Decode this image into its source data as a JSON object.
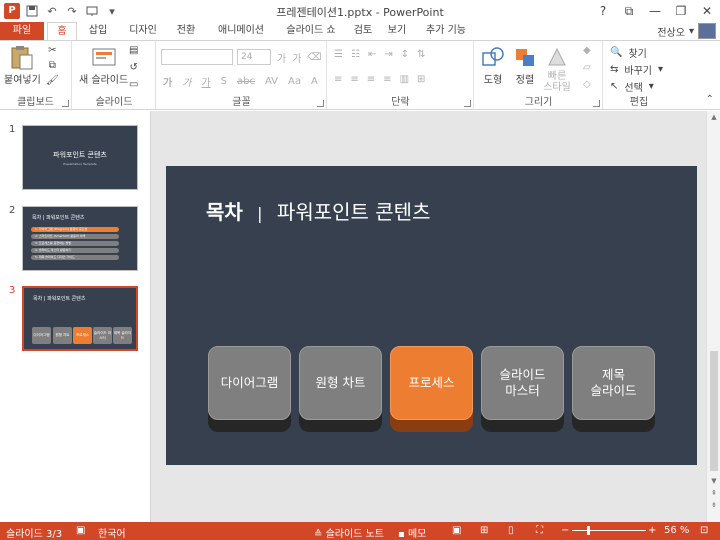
{
  "window": {
    "title": "프레젠테이션1.pptx - PowerPoint",
    "app_icon": "P",
    "controls": [
      "?",
      "⧉",
      "—",
      "❐",
      "✕"
    ]
  },
  "tabs": [
    {
      "label": "파일"
    },
    {
      "label": "홈"
    },
    {
      "label": "삽입"
    },
    {
      "label": "디자인"
    },
    {
      "label": "전환"
    },
    {
      "label": "애니메이션"
    },
    {
      "label": "슬라이드 쇼"
    },
    {
      "label": "검토"
    },
    {
      "label": "보기"
    },
    {
      "label": "추가 기능"
    }
  ],
  "user": {
    "name": "전상오",
    "menu": "▾"
  },
  "ribbon": {
    "clipboard": {
      "label": "클립보드",
      "paste": "붙여넣기"
    },
    "slides": {
      "label": "슬라이드",
      "new_slide": "새 슬라이드"
    },
    "font": {
      "label": "글꼴",
      "size": "24",
      "bold": "가",
      "italic": "가",
      "underline": "가",
      "shadow": "S",
      "strike": "abc",
      "spacing": "AV",
      "case": "Aa",
      "grow": "가",
      "shrink": "가"
    },
    "paragraph": {
      "label": "단락"
    },
    "drawing": {
      "label": "그리기",
      "shapes": "도형",
      "arrange": "정렬",
      "quick_styles": "빠른\n스타일"
    },
    "editing": {
      "label": "편집",
      "find": "찾기",
      "replace": "바꾸기",
      "select": "선택"
    }
  },
  "thumbnails": [
    {
      "num": "1",
      "title": "파워포인트 콘텐츠",
      "subtitle": "Presentation Template"
    },
    {
      "num": "2",
      "title": "목차 | 파워포인트 콘텐츠",
      "items": [
        "1. 다이어그램 (Diagram) 활용의 중요성",
        "2. 스마트아트 (SmartArt) 활용의 이해",
        "3. 프로세스를 표현하는 방법",
        "4. 슬라이드 마스터 활용하기",
        "5. 제목 슬라이드 디자인 가이드"
      ]
    },
    {
      "num": "3",
      "title": "목차 | 파워포인트 콘텐츠",
      "buttons": [
        "다이어그램",
        "원형 차트",
        "프로세스",
        "슬라이드 마스터",
        "제목 슬라이드"
      ]
    }
  ],
  "slide": {
    "title_bold": "목차",
    "title_sep": "|",
    "title_rest": "파워포인트 콘텐츠",
    "buttons": [
      {
        "label": "다이어그램",
        "highlight": false
      },
      {
        "label": "원형 차트",
        "highlight": false
      },
      {
        "label": "프로세스",
        "highlight": true
      },
      {
        "label": "슬라이드\n마스터",
        "highlight": false
      },
      {
        "label": "제목\n슬라이드",
        "highlight": false
      }
    ]
  },
  "status": {
    "slide": "슬라이드 3/3",
    "language": "한국어",
    "notes": "슬라이드 노트",
    "comments": "메모",
    "zoom": "56 %"
  },
  "colors": {
    "accent": "#d24726",
    "slide_bg": "#36404f",
    "orange": "#ed7d31",
    "gray_btn": "#7f7f7f"
  }
}
